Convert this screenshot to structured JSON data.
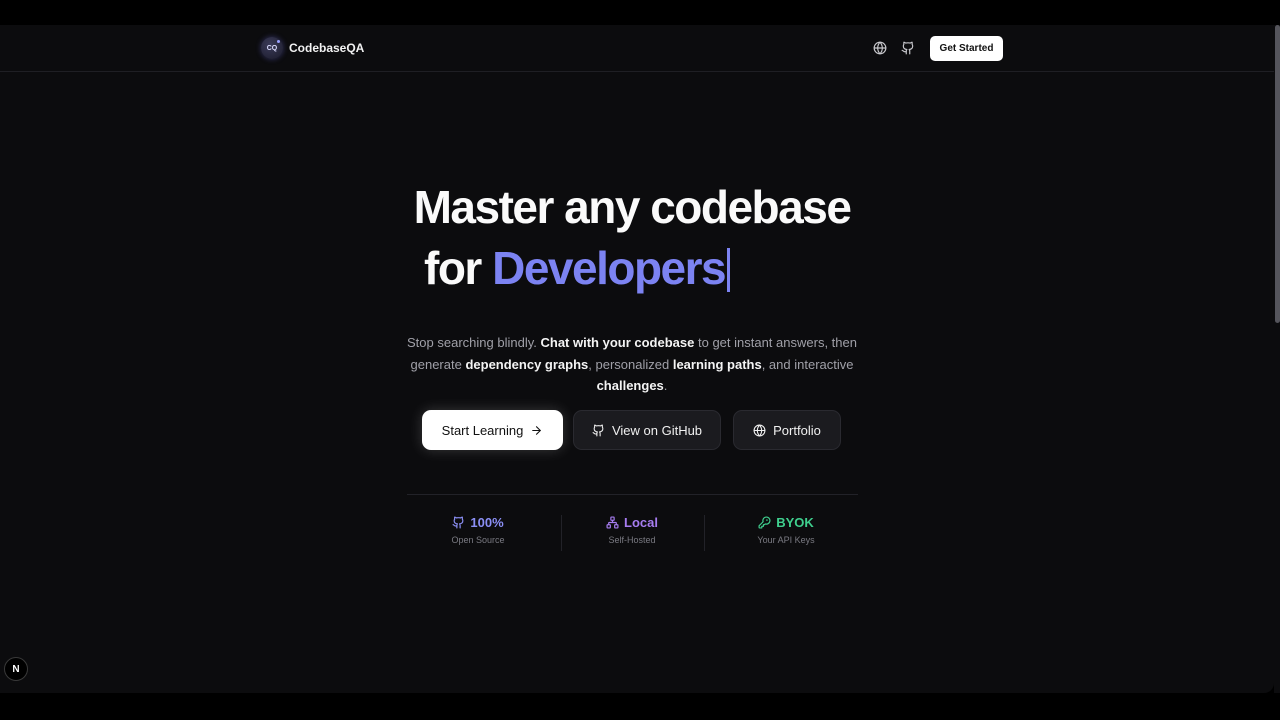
{
  "nav": {
    "brand_logo_text": "CQ",
    "brand_name": "CodebaseQA",
    "get_started_label": "Get Started",
    "icons": [
      "globe-icon",
      "github-icon"
    ]
  },
  "hero": {
    "headline_line1": "Master any codebase",
    "headline_prefix": "for",
    "headline_accent": "Developers",
    "subtitle": {
      "p1": "Stop searching blindly.",
      "b1": "Chat with your codebase",
      "p2": "to get instant answers, then generate",
      "b2": "dependency graphs",
      "p3": ", personalized",
      "b3": "learning paths",
      "p4": ", and interactive",
      "b4": "challenges",
      "p5": "."
    },
    "buttons": {
      "start_learning": "Start Learning",
      "view_github": "View on GitHub",
      "portfolio": "Portfolio"
    }
  },
  "stats": [
    {
      "value": "100%",
      "label": "Open Source",
      "color": "#8b8ff5",
      "icon": "github-icon"
    },
    {
      "value": "Local",
      "label": "Self-Hosted",
      "color": "#a67cf0",
      "icon": "network-icon"
    },
    {
      "value": "BYOK",
      "label": "Your API Keys",
      "color": "#3fcf8e",
      "icon": "key-icon"
    }
  ],
  "colors": {
    "accent": "#7c83f2",
    "background": "#0c0c0e"
  },
  "dev_badge": "N"
}
